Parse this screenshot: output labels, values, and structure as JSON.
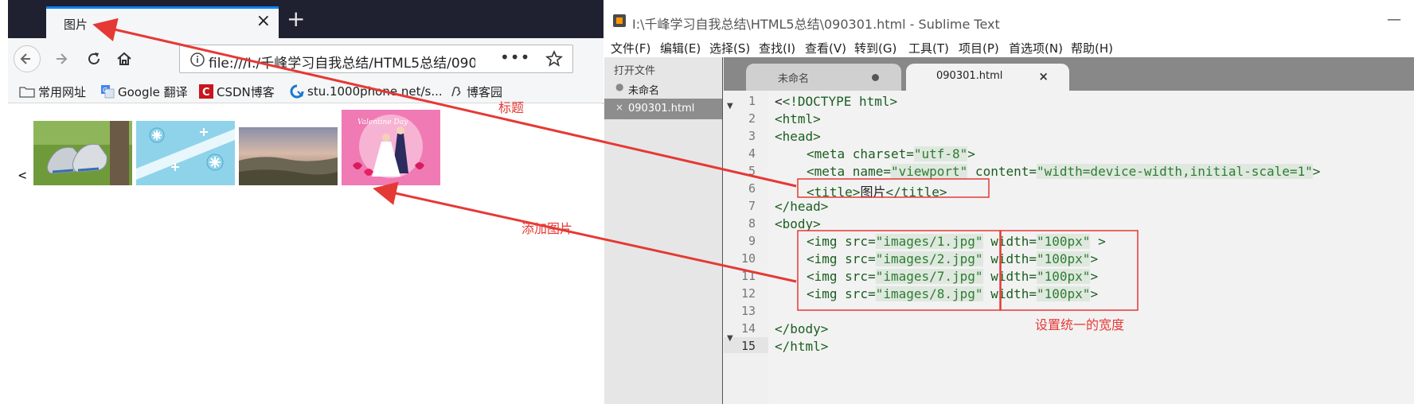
{
  "browser": {
    "tab_title": "图片",
    "tab_close": "×",
    "new_tab": "+",
    "url": "file:///I:/千峰学习自我总结/HTML5总结/090",
    "url_more": "•••",
    "bookmarks": [
      "常用网址",
      "Google 翻译",
      "CSDN博客",
      "stu.1000phone.net/s...",
      "博客园"
    ],
    "page_text": "<",
    "images": [
      {
        "name": "sneakers-image"
      },
      {
        "name": "snowflake-pattern-image"
      },
      {
        "name": "landscape-image"
      },
      {
        "name": "valentine-couple-image",
        "label": "Valentine Day"
      }
    ]
  },
  "sublime": {
    "title": "I:\\千峰学习自我总结\\HTML5总结\\090301.html - Sublime Text",
    "minimize": "—",
    "menu": [
      "文件(F)",
      "编辑(E)",
      "选择(S)",
      "查找(I)",
      "查看(V)",
      "转到(G)",
      "工具(T)",
      "项目(P)",
      "首选项(N)",
      "帮助(H)"
    ],
    "sidebar_header": "打开文件",
    "sidebar_files": [
      {
        "name": "未命名",
        "mark": "●"
      },
      {
        "name": "090301.html",
        "mark": "×"
      }
    ],
    "tabs": [
      {
        "label": "未命名",
        "dirty": true
      },
      {
        "label": "090301.html",
        "close": "×"
      }
    ],
    "line_numbers": [
      "1",
      "2",
      "3",
      "4",
      "5",
      "6",
      "7",
      "8",
      "9",
      "10",
      "11",
      "12",
      "13",
      "14",
      "15"
    ],
    "code": {
      "l1": {
        "a": "<",
        "b": "<!DOCTYPE html>"
      },
      "l2": "<html>",
      "l3": "<head>",
      "l4": {
        "t": "<meta charset=",
        "v": "\"utf-8\"",
        "e": ">"
      },
      "l5": {
        "t": "<meta name=",
        "v1": "\"viewport\"",
        "m": " content=",
        "v2": "\"width=device-width,initial-scale=1\"",
        "e": ">"
      },
      "l6": {
        "t1": "<title>",
        "x": "图片",
        "t2": "</title>"
      },
      "l7": "</head>",
      "l8": "<body>",
      "l9": {
        "t": "<img src=",
        "v": "\"images/1.jpg\"",
        "w": " width=",
        "wv": "\"100px\"",
        "e": " >"
      },
      "l10": {
        "t": "<img src=",
        "v": "\"images/2.jpg\"",
        "w": " width=",
        "wv": "\"100px\"",
        "e": ">"
      },
      "l11": {
        "t": "<img src=",
        "v": "\"images/7.jpg\"",
        "w": " width=",
        "wv": "\"100px\"",
        "e": ">"
      },
      "l12": {
        "t": "<img src=",
        "v": "\"images/8.jpg\"",
        "w": " width=",
        "wv": "\"100px\"",
        "e": ">"
      },
      "l14": "</body>",
      "l15": "</html>"
    }
  },
  "annotations": {
    "title_note": "标题",
    "add_image_note": "添加图片",
    "width_note": "设置统一的宽度",
    "color": "#e53935"
  }
}
